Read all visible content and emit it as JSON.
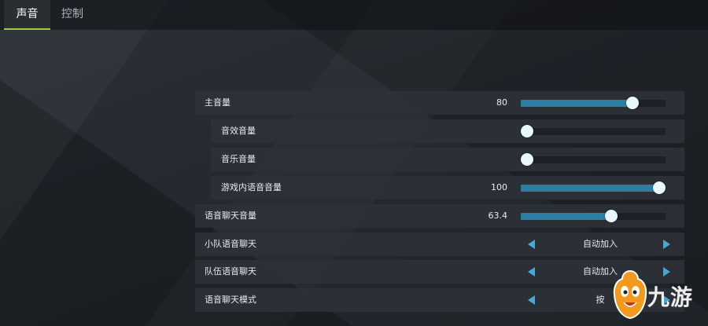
{
  "tabs": [
    {
      "label": "声音",
      "active": true
    },
    {
      "label": "控制",
      "active": false
    }
  ],
  "settings": [
    {
      "type": "slider",
      "label": "主音量",
      "value_text": "80",
      "value": 80,
      "max": 100,
      "indent": 0
    },
    {
      "type": "slider",
      "label": "音效音量",
      "value_text": "",
      "value": 0,
      "max": 100,
      "indent": 1
    },
    {
      "type": "slider",
      "label": "音乐音量",
      "value_text": "",
      "value": 0,
      "max": 100,
      "indent": 1
    },
    {
      "type": "slider",
      "label": "游戏内语音音量",
      "value_text": "100",
      "value": 100,
      "max": 100,
      "indent": 1
    },
    {
      "type": "slider",
      "label": "语音聊天音量",
      "value_text": "63.4",
      "value": 63.4,
      "max": 100,
      "indent": 0
    },
    {
      "type": "option",
      "label": "小队语音聊天",
      "value_text": "自动加入",
      "indent": 0
    },
    {
      "type": "option",
      "label": "队伍语音聊天",
      "value_text": "自动加入",
      "indent": 0
    },
    {
      "type": "option",
      "label": "语音聊天模式",
      "value_text": "按",
      "indent": 0
    }
  ],
  "watermark": {
    "text": "九游"
  },
  "colors": {
    "accent_tab": "#9fcb39",
    "slider_fill": "#2a7fa2",
    "slider_track": "#1c2125",
    "arrow": "#4aa6d6",
    "knob": "#e9f7ff",
    "logo_orange": "#f39a1e"
  },
  "icons": {
    "prev": "triangle-left-icon",
    "next": "triangle-right-icon",
    "logo": "jiuyou-logo-icon"
  }
}
